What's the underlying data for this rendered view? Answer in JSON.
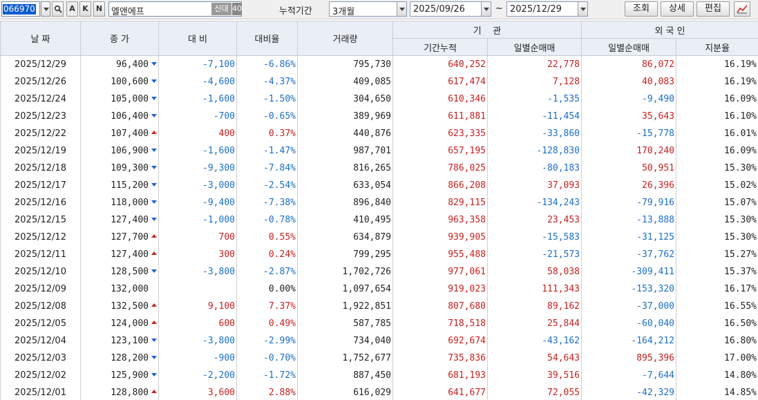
{
  "toolbar": {
    "stock_code": "066970",
    "btn_search_glyph": "🔍",
    "btn_a": "A",
    "btn_k": "K",
    "btn_n": "N",
    "stock_name": "엘앤에프",
    "tag_new": "신대",
    "tag_40": "40",
    "period_label": "누적기간",
    "period_value": "3개월",
    "date_from": "2025/09/26",
    "date_sep": "~",
    "date_to": "2025/12/29",
    "btn_query": "조회",
    "btn_detail": "상세",
    "btn_edit": "편집",
    "chart_icon": "line-chart-icon"
  },
  "headers": {
    "date": "날 짜",
    "close": "종 가",
    "change": "대 비",
    "rate": "대비율",
    "volume": "거래량",
    "inst": "기    관",
    "inst_cum": "기간누적",
    "inst_daily": "일별순매매",
    "foreign": "외 국 인",
    "for_daily": "일별순매매",
    "for_share": "지분율"
  },
  "colors": {
    "up": "#c81e1e",
    "down": "#1a6ec8",
    "header_bg": "#eaeef5"
  },
  "rows": [
    {
      "date": "2025/12/29",
      "close": "96,400",
      "dir": "down",
      "change": "-7,100",
      "rate": "-6.86%",
      "volume": "795,730",
      "inst_cum": "640,252",
      "inst_daily": "22,778",
      "for_daily": "86,072",
      "for_share": "16.19%"
    },
    {
      "date": "2025/12/26",
      "close": "100,600",
      "dir": "down",
      "change": "-4,600",
      "rate": "-4.37%",
      "volume": "409,085",
      "inst_cum": "617,474",
      "inst_daily": "7,128",
      "for_daily": "40,083",
      "for_share": "16.19%"
    },
    {
      "date": "2025/12/24",
      "close": "105,000",
      "dir": "down",
      "change": "-1,600",
      "rate": "-1.50%",
      "volume": "304,650",
      "inst_cum": "610,346",
      "inst_daily": "-1,535",
      "for_daily": "-9,490",
      "for_share": "16.09%"
    },
    {
      "date": "2025/12/23",
      "close": "106,400",
      "dir": "down",
      "change": "-700",
      "rate": "-0.65%",
      "volume": "389,969",
      "inst_cum": "611,881",
      "inst_daily": "-11,454",
      "for_daily": "35,643",
      "for_share": "16.10%"
    },
    {
      "date": "2025/12/22",
      "close": "107,400",
      "dir": "up",
      "change": "400",
      "rate": "0.37%",
      "volume": "440,876",
      "inst_cum": "623,335",
      "inst_daily": "-33,860",
      "for_daily": "-15,778",
      "for_share": "16.01%"
    },
    {
      "date": "2025/12/19",
      "close": "106,900",
      "dir": "down",
      "change": "-1,600",
      "rate": "-1.47%",
      "volume": "987,701",
      "inst_cum": "657,195",
      "inst_daily": "-128,830",
      "for_daily": "170,240",
      "for_share": "16.09%"
    },
    {
      "date": "2025/12/18",
      "close": "109,300",
      "dir": "down",
      "change": "-9,300",
      "rate": "-7.84%",
      "volume": "816,265",
      "inst_cum": "786,025",
      "inst_daily": "-80,183",
      "for_daily": "50,951",
      "for_share": "15.30%"
    },
    {
      "date": "2025/12/17",
      "close": "115,200",
      "dir": "down",
      "change": "-3,000",
      "rate": "-2.54%",
      "volume": "633,054",
      "inst_cum": "866,208",
      "inst_daily": "37,093",
      "for_daily": "26,396",
      "for_share": "15.02%"
    },
    {
      "date": "2025/12/16",
      "close": "118,000",
      "dir": "down",
      "change": "-9,400",
      "rate": "-7.38%",
      "volume": "896,840",
      "inst_cum": "829,115",
      "inst_daily": "-134,243",
      "for_daily": "-79,916",
      "for_share": "15.07%"
    },
    {
      "date": "2025/12/15",
      "close": "127,400",
      "dir": "down",
      "change": "-1,000",
      "rate": "-0.78%",
      "volume": "410,495",
      "inst_cum": "963,358",
      "inst_daily": "23,453",
      "for_daily": "-13,888",
      "for_share": "15.30%"
    },
    {
      "date": "2025/12/12",
      "close": "127,700",
      "dir": "up",
      "change": "700",
      "rate": "0.55%",
      "volume": "634,879",
      "inst_cum": "939,905",
      "inst_daily": "-15,583",
      "for_daily": "-31,125",
      "for_share": "15.30%"
    },
    {
      "date": "2025/12/11",
      "close": "127,400",
      "dir": "up",
      "change": "300",
      "rate": "0.24%",
      "volume": "799,295",
      "inst_cum": "955,488",
      "inst_daily": "-21,573",
      "for_daily": "-37,762",
      "for_share": "15.27%"
    },
    {
      "date": "2025/12/10",
      "close": "128,500",
      "dir": "down",
      "change": "-3,800",
      "rate": "-2.87%",
      "volume": "1,702,726",
      "inst_cum": "977,061",
      "inst_daily": "58,038",
      "for_daily": "-309,411",
      "for_share": "15.37%"
    },
    {
      "date": "2025/12/09",
      "close": "132,000",
      "dir": "flat",
      "change": "",
      "rate": "0.00%",
      "volume": "1,097,654",
      "inst_cum": "919,023",
      "inst_daily": "111,343",
      "for_daily": "-153,320",
      "for_share": "16.17%"
    },
    {
      "date": "2025/12/08",
      "close": "132,500",
      "dir": "up",
      "change": "9,100",
      "rate": "7.37%",
      "volume": "1,922,851",
      "inst_cum": "807,680",
      "inst_daily": "89,162",
      "for_daily": "-37,000",
      "for_share": "16.55%"
    },
    {
      "date": "2025/12/05",
      "close": "124,000",
      "dir": "up",
      "change": "600",
      "rate": "0.49%",
      "volume": "587,785",
      "inst_cum": "718,518",
      "inst_daily": "25,844",
      "for_daily": "-60,040",
      "for_share": "16.50%"
    },
    {
      "date": "2025/12/04",
      "close": "123,100",
      "dir": "down",
      "change": "-3,800",
      "rate": "-2.99%",
      "volume": "734,040",
      "inst_cum": "692,674",
      "inst_daily": "-43,162",
      "for_daily": "-164,212",
      "for_share": "16.80%"
    },
    {
      "date": "2025/12/03",
      "close": "128,200",
      "dir": "down",
      "change": "-900",
      "rate": "-0.70%",
      "volume": "1,752,677",
      "inst_cum": "735,836",
      "inst_daily": "54,643",
      "for_daily": "895,396",
      "for_share": "17.00%"
    },
    {
      "date": "2025/12/02",
      "close": "125,900",
      "dir": "down",
      "change": "-2,200",
      "rate": "-1.72%",
      "volume": "887,450",
      "inst_cum": "681,193",
      "inst_daily": "39,516",
      "for_daily": "-7,644",
      "for_share": "14.80%"
    },
    {
      "date": "2025/12/01",
      "close": "128,800",
      "dir": "up",
      "change": "3,600",
      "rate": "2.88%",
      "volume": "616,029",
      "inst_cum": "641,677",
      "inst_daily": "72,055",
      "for_daily": "-42,329",
      "for_share": "14.85%"
    }
  ]
}
